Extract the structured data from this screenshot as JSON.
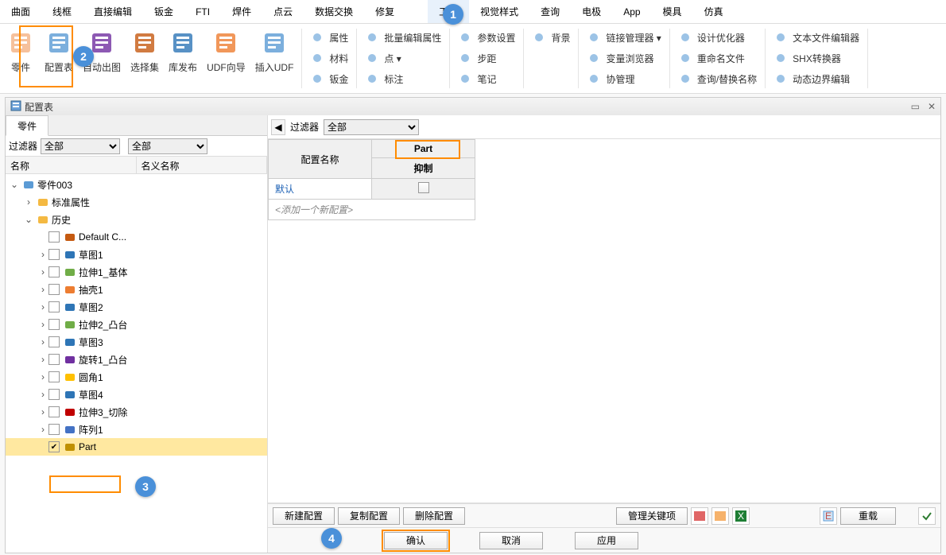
{
  "menu": [
    "曲面",
    "线框",
    "直接编辑",
    "钣金",
    "FTI",
    "焊件",
    "点云",
    "数据交换",
    "修复",
    "",
    "工具",
    "视觉样式",
    "查询",
    "电极",
    "App",
    "模具",
    "仿真"
  ],
  "menu_active_index": 10,
  "ribbon": {
    "big": [
      {
        "label": "零件",
        "icon": "part"
      },
      {
        "label": "配置表",
        "icon": "cfgtable"
      },
      {
        "label": "自动出图",
        "icon": "autodwg"
      },
      {
        "label": "选择集",
        "icon": "selset"
      },
      {
        "label": "库发布",
        "icon": "libpub"
      },
      {
        "label": "UDF向导",
        "icon": "udfwiz"
      },
      {
        "label": "插入UDF",
        "icon": "udfins"
      }
    ],
    "cols": [
      [
        {
          "label": "属性",
          "icon": "prop"
        },
        {
          "label": "材料",
          "icon": "mat"
        },
        {
          "label": "钣金",
          "icon": "sm"
        }
      ],
      [
        {
          "label": "批量编辑属性",
          "icon": "batch"
        },
        {
          "label": "点 ▾",
          "icon": "pt"
        },
        {
          "label": "标注",
          "icon": "dim"
        }
      ],
      [
        {
          "label": "参数设置",
          "icon": "param"
        },
        {
          "label": "步距",
          "icon": "step"
        },
        {
          "label": "笔记",
          "icon": "note"
        }
      ],
      [
        {
          "label": "背景",
          "icon": "bg"
        },
        {
          "label": "",
          "icon": ""
        },
        {
          "label": "",
          "icon": ""
        }
      ],
      [
        {
          "label": "链接管理器 ▾",
          "icon": "link"
        },
        {
          "label": "变量浏览器",
          "icon": "var"
        },
        {
          "label": "协管理",
          "icon": "mgr"
        }
      ],
      [
        {
          "label": "设计优化器",
          "icon": "opt"
        },
        {
          "label": "重命名文件",
          "icon": "ren"
        },
        {
          "label": "查询/替换名称",
          "icon": "find"
        }
      ],
      [
        {
          "label": "文本文件编辑器",
          "icon": "txt"
        },
        {
          "label": "SHX转换器",
          "icon": "shx"
        },
        {
          "label": "动态边界编辑",
          "icon": "dyn"
        }
      ]
    ]
  },
  "panel": {
    "title": "配置表",
    "left": {
      "tab": "零件",
      "filter_label": "过滤器",
      "filter1": "全部",
      "filter2": "全部",
      "col_name": "名称",
      "col_nominal": "名义名称",
      "tree": [
        {
          "d": 0,
          "tw": "v",
          "cb": false,
          "icon": "asm",
          "label": "零件003",
          "sel": false
        },
        {
          "d": 1,
          "tw": ">",
          "cb": false,
          "icon": "fld",
          "label": "标准属性",
          "sel": false
        },
        {
          "d": 1,
          "tw": "v",
          "cb": false,
          "icon": "fld",
          "label": "历史",
          "sel": false
        },
        {
          "d": 2,
          "tw": "",
          "cb": true,
          "checked": false,
          "icon": "csys",
          "label": "Default C...",
          "sel": false
        },
        {
          "d": 2,
          "tw": ">",
          "cb": true,
          "checked": false,
          "icon": "sk",
          "label": "草图1",
          "sel": false
        },
        {
          "d": 2,
          "tw": ">",
          "cb": true,
          "checked": false,
          "icon": "ext",
          "label": "拉伸1_基体",
          "sel": false
        },
        {
          "d": 2,
          "tw": ">",
          "cb": true,
          "checked": false,
          "icon": "shl",
          "label": "抽壳1",
          "sel": false
        },
        {
          "d": 2,
          "tw": ">",
          "cb": true,
          "checked": false,
          "icon": "sk",
          "label": "草图2",
          "sel": false
        },
        {
          "d": 2,
          "tw": ">",
          "cb": true,
          "checked": false,
          "icon": "ext",
          "label": "拉伸2_凸台",
          "sel": false
        },
        {
          "d": 2,
          "tw": ">",
          "cb": true,
          "checked": false,
          "icon": "sk",
          "label": "草图3",
          "sel": false
        },
        {
          "d": 2,
          "tw": ">",
          "cb": true,
          "checked": false,
          "icon": "rev",
          "label": "旋转1_凸台",
          "sel": false
        },
        {
          "d": 2,
          "tw": ">",
          "cb": true,
          "checked": false,
          "icon": "fil",
          "label": "圆角1",
          "sel": false
        },
        {
          "d": 2,
          "tw": ">",
          "cb": true,
          "checked": false,
          "icon": "sk",
          "label": "草图4",
          "sel": false
        },
        {
          "d": 2,
          "tw": ">",
          "cb": true,
          "checked": false,
          "icon": "cut",
          "label": "拉伸3_切除",
          "sel": false
        },
        {
          "d": 2,
          "tw": ">",
          "cb": true,
          "checked": false,
          "icon": "pat",
          "label": "阵列1",
          "sel": false
        },
        {
          "d": 2,
          "tw": "",
          "cb": true,
          "checked": true,
          "icon": "scale",
          "label": "Part",
          "sel": true
        }
      ]
    },
    "right": {
      "filter_label": "过滤器",
      "filter_value": "全部",
      "col_cfgname": "配置名称",
      "col_part": "Part",
      "col_suppress": "抑制",
      "row_default": "默认",
      "row_add": "<添加一个新配置>",
      "buttons": {
        "new": "新建配置",
        "copy": "复制配置",
        "del": "删除配置",
        "keys": "管理关键项",
        "reload": "重载",
        "ok": "确认",
        "cancel": "取消",
        "apply": "应用"
      }
    }
  },
  "callouts": {
    "c1": "1",
    "c2": "2",
    "c3": "3",
    "c4": "4"
  }
}
